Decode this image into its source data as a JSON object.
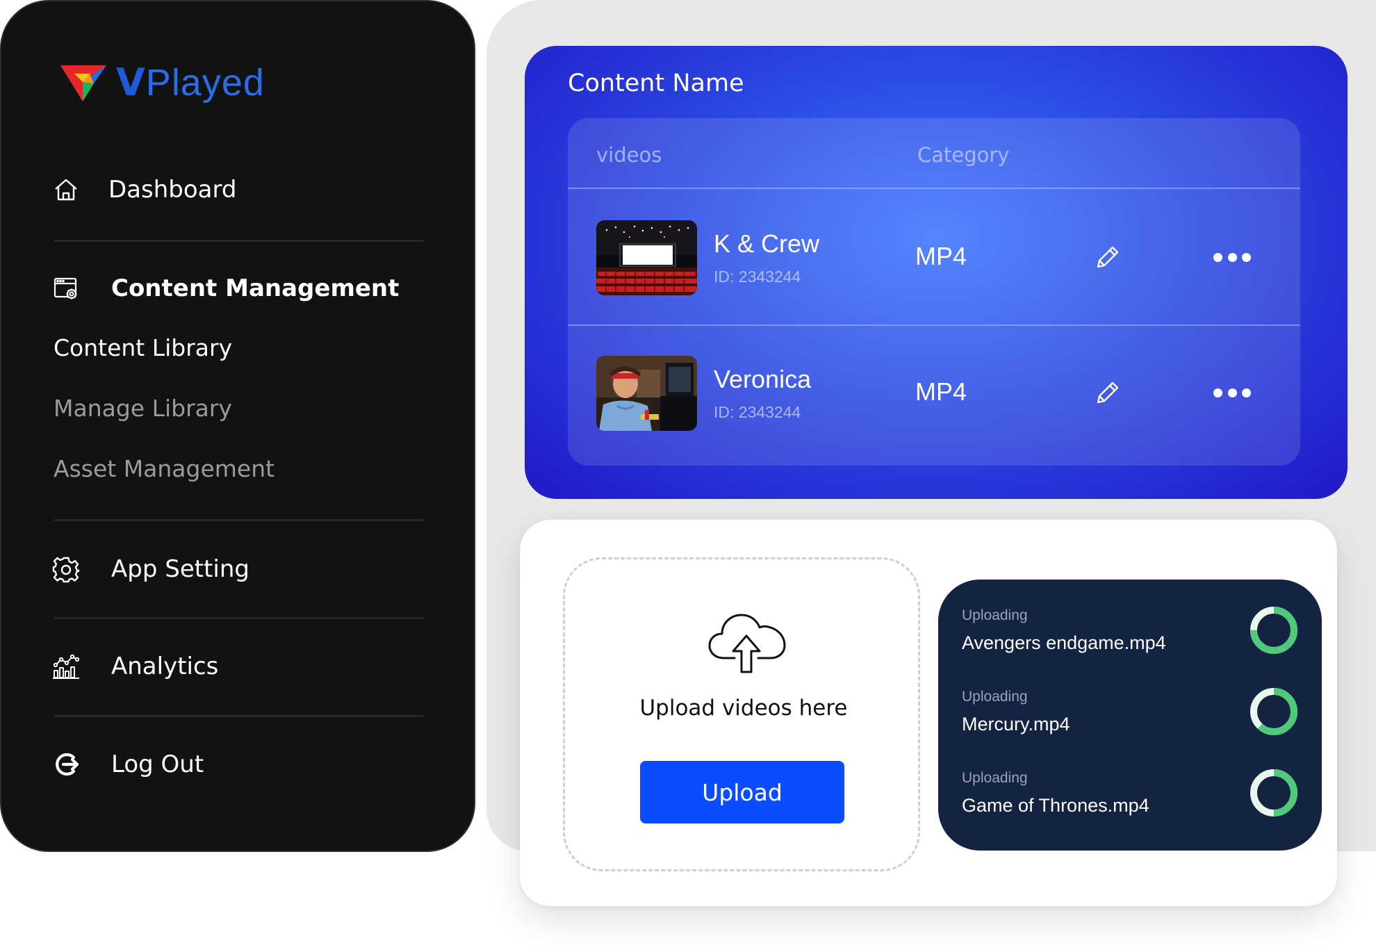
{
  "brand": {
    "logo_v": "V",
    "logo_rest": "Played",
    "colors": {
      "primary": "#1d5bd8",
      "logo_red": "#e8262c",
      "logo_yellow": "#f5c518",
      "logo_green": "#1bb55c",
      "logo_blue": "#1e6ef0"
    }
  },
  "sidebar": {
    "items": [
      {
        "label": "Dashboard",
        "icon": "home-icon"
      },
      {
        "label": "Content Management",
        "icon": "browser-gear-icon"
      },
      {
        "label": "App Setting",
        "icon": "gear-icon"
      },
      {
        "label": "Analytics",
        "icon": "analytics-icon"
      },
      {
        "label": "Log Out",
        "icon": "logout-icon"
      }
    ],
    "sub_items": [
      {
        "label": "Content Library",
        "state": "active"
      },
      {
        "label": "Manage Library",
        "state": "inactive"
      },
      {
        "label": "Asset Management",
        "state": "inactive"
      }
    ]
  },
  "content": {
    "title": "Content Name",
    "columns": {
      "videos": "videos",
      "category": "Category"
    },
    "rows": [
      {
        "title": "K & Crew",
        "id": "ID: 2343244",
        "category": "MP4",
        "thumb": "cinema-hall-thumbnail"
      },
      {
        "title": "Veronica",
        "id": "ID: 2343244",
        "category": "MP4",
        "thumb": "man-at-computer-thumbnail"
      }
    ]
  },
  "upload": {
    "drop_text": "Upload videos here",
    "button_label": "Upload",
    "queue": [
      {
        "status": "Uploading",
        "file": "Avengers endgame.mp4",
        "progress": 0.75
      },
      {
        "status": "Uploading",
        "file": "Mercury.mp4",
        "progress": 0.62
      },
      {
        "status": "Uploading",
        "file": "Game of Thrones.mp4",
        "progress": 0.5
      }
    ],
    "colors": {
      "button": "#0b4dfe",
      "ring_progress": "#4fc97a",
      "ring_track": "#e8f6ec",
      "queue_bg": "#142341"
    }
  }
}
